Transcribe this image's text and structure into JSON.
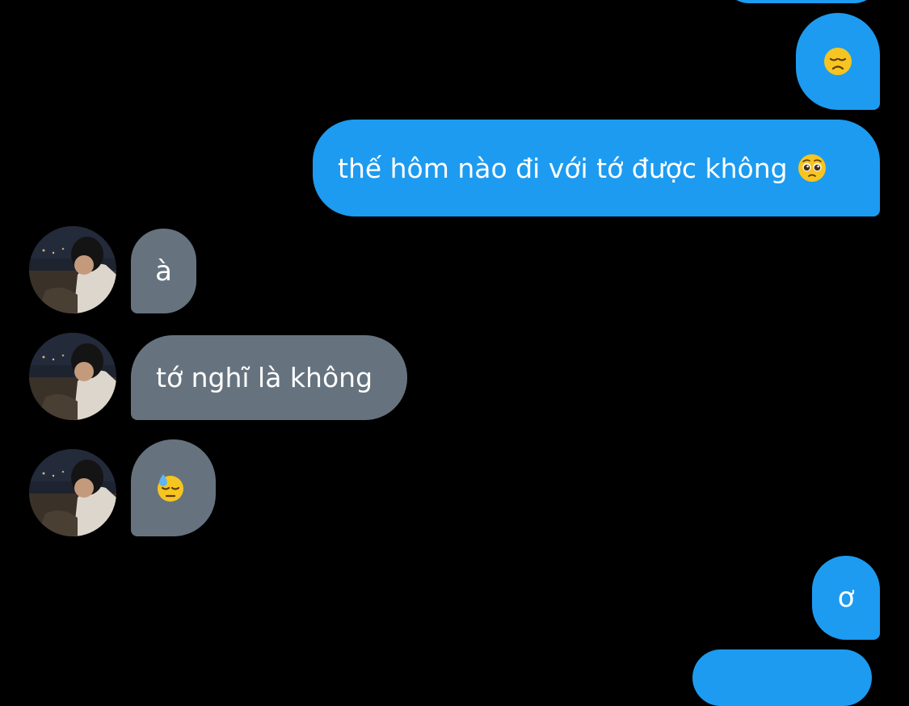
{
  "colors": {
    "background": "#000000",
    "sent_bubble": "#1d9bf0",
    "received_bubble": "#66737f",
    "text": "#ffffff"
  },
  "messages": [
    {
      "id": "partial-top",
      "sender": "me",
      "text": ""
    },
    {
      "id": "m1",
      "sender": "me",
      "text": "",
      "emoji": "disappointed-face-icon"
    },
    {
      "id": "m2",
      "sender": "me",
      "text": "thế hôm nào đi với tớ được không",
      "emoji": "pleading-face-icon"
    },
    {
      "id": "m3",
      "sender": "them",
      "text": "à"
    },
    {
      "id": "m4",
      "sender": "them",
      "text": "tớ nghĩ là không"
    },
    {
      "id": "m5",
      "sender": "them",
      "text": "",
      "emoji": "downcast-sweat-face-icon"
    },
    {
      "id": "m6",
      "sender": "me",
      "text": "ơ"
    },
    {
      "id": "partial-bottom",
      "sender": "me",
      "text": ""
    }
  ]
}
